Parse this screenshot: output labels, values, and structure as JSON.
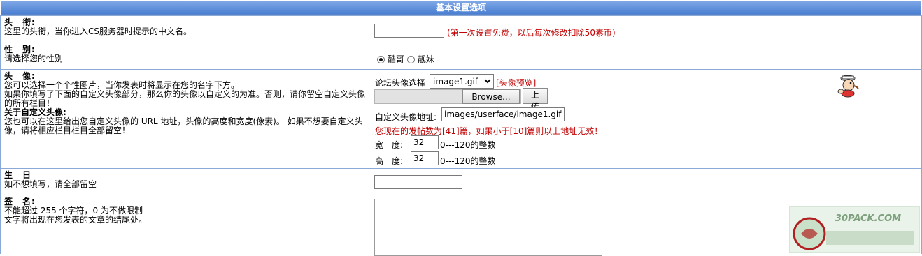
{
  "header": {
    "title": "基本设置选项"
  },
  "rows": {
    "title": {
      "label": "头　衔:",
      "desc": "这里的头衔，当你进入CS服务器时提示的中文名。",
      "input_value": "",
      "note": "(第一次设置免费，以后每次修改扣除50素币)"
    },
    "gender": {
      "label": "性　别:",
      "desc": "请选择您的性别",
      "options": [
        "酷哥",
        "靓妹"
      ],
      "selected": "酷哥"
    },
    "avatar": {
      "label": "头　像:",
      "desc_lines": [
        "您可以选择一个个性图片，当你发表时将显示在您的名字下方。",
        "如果你填写了下面的自定义头像部分，那么你的头像以自定义的为准。否则，请你留空自定义头像",
        "的所有栏目！"
      ],
      "custom_label": "关于自定义头像:",
      "custom_desc_lines": [
        "您也可以在这里给出您自定义头像的 URL 地址，头像的高度和宽度(像素)。 如果不想要自定义头",
        "像，请将相应栏目栏目全部留空！"
      ],
      "select_label": "论坛头像选择",
      "select_value": "image1.gif",
      "preview_link": "[头像预览]",
      "browse_label": "Browse...",
      "upload_label": "上传",
      "custom_url_label": "自定义头像地址:",
      "custom_url_value": "images/userface/image1.gif",
      "warning": "您现在的发帖数为[41]篇，如果小于[10]篇则以上地址无效！",
      "width_label": "宽　度:",
      "width_value": "32",
      "height_label": "高　度:",
      "height_value": "32",
      "range_hint": "0---120的整数"
    },
    "birthday": {
      "label": "生　日",
      "desc": "如不想填写，请全部留空",
      "input_value": ""
    },
    "signature": {
      "label": "签　名:",
      "desc_lines": [
        "不能超过 255 个字符，0 为不做限制",
        "文字将出现在您发表的文章的结尾处。"
      ],
      "value": ""
    }
  },
  "watermark": {
    "url_text": "30PACK.COM"
  }
}
